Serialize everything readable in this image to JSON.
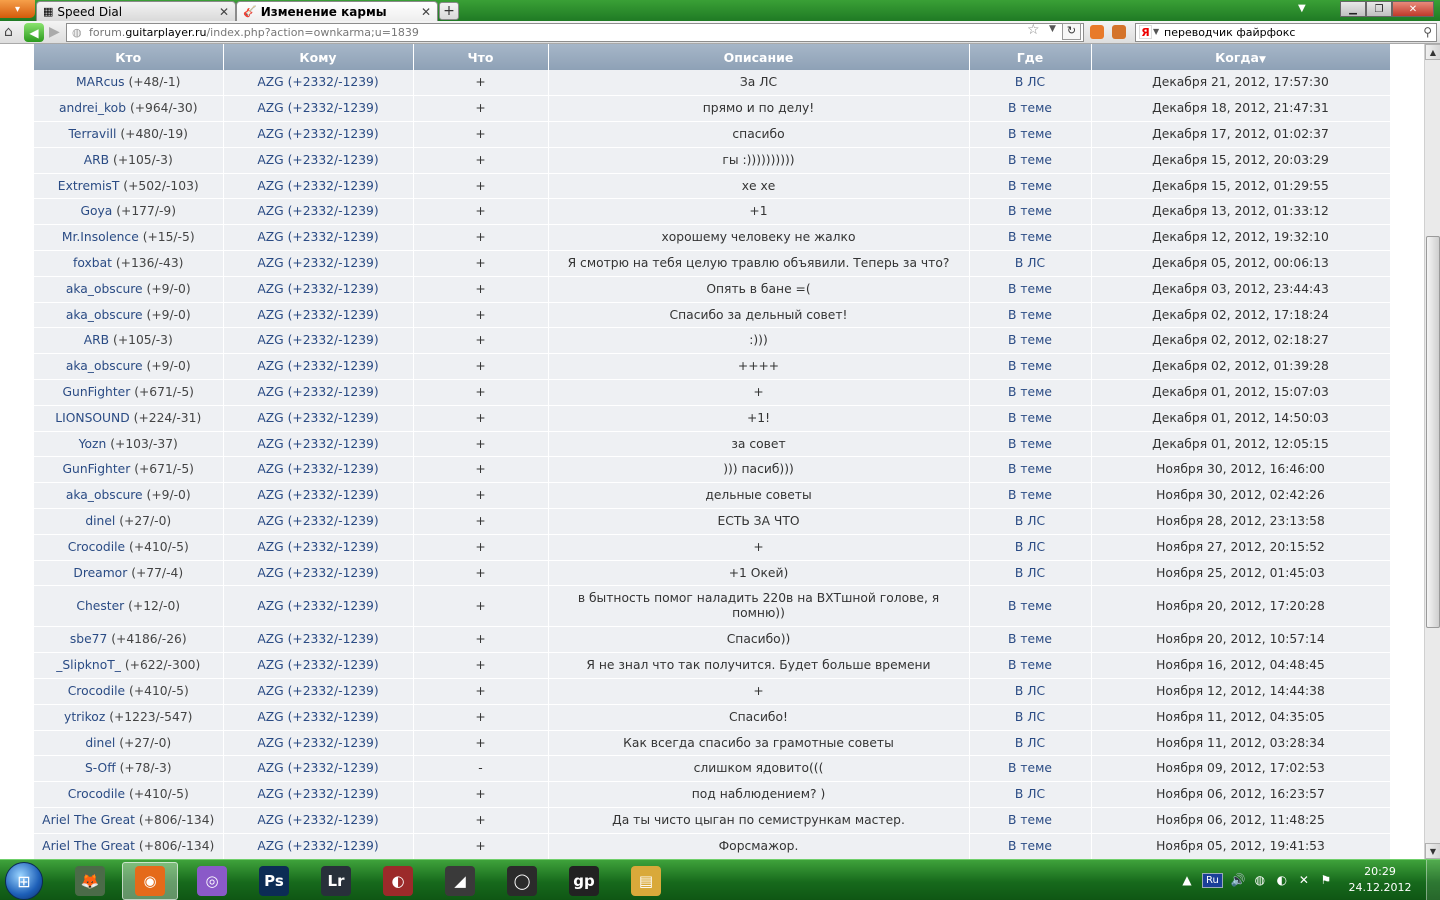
{
  "browser": {
    "firefox_button": "▾",
    "tabs": [
      {
        "title": "Speed Dial",
        "icon": "grid-icon",
        "active": false
      },
      {
        "title": "Изменение кармы",
        "icon": "guitar-icon",
        "active": true
      }
    ],
    "new_tab": "+",
    "url_prefix": "forum.",
    "url_domain": "guitarplayer.ru",
    "url_path": "/index.php?action=ownkarma;u=1839",
    "search_query": "переводчик файрфокс",
    "search_engine": "Я"
  },
  "table": {
    "headers": {
      "who": "Кто",
      "to": "Кому",
      "what": "Что",
      "desc": "Описание",
      "where": "Где",
      "when": "Когда"
    },
    "rows": [
      {
        "who": "MARcus",
        "score": "(+48/-1)",
        "to": "AZG (+2332/-1239)",
        "what": "+",
        "desc": "За ЛС",
        "where": "В ЛС",
        "when": "Декабря 21, 2012, 17:57:30"
      },
      {
        "who": "andrei_kob",
        "score": "(+964/-30)",
        "to": "AZG (+2332/-1239)",
        "what": "+",
        "desc": "прямо и по делу!",
        "where": "В теме",
        "when": "Декабря 18, 2012, 21:47:31"
      },
      {
        "who": "Terravill",
        "score": "(+480/-19)",
        "to": "AZG (+2332/-1239)",
        "what": "+",
        "desc": "спасибо",
        "where": "В теме",
        "when": "Декабря 17, 2012, 01:02:37"
      },
      {
        "who": "ARB",
        "score": "(+105/-3)",
        "to": "AZG (+2332/-1239)",
        "what": "+",
        "desc": "гы :))))))))))",
        "where": "В теме",
        "when": "Декабря 15, 2012, 20:03:29"
      },
      {
        "who": "ExtremisT",
        "score": "(+502/-103)",
        "to": "AZG (+2332/-1239)",
        "what": "+",
        "desc": "хе хе",
        "where": "В теме",
        "when": "Декабря 15, 2012, 01:29:55"
      },
      {
        "who": "Goya",
        "score": "(+177/-9)",
        "to": "AZG (+2332/-1239)",
        "what": "+",
        "desc": "+1",
        "where": "В теме",
        "when": "Декабря 13, 2012, 01:33:12"
      },
      {
        "who": "Mr.Insolence",
        "score": "(+15/-5)",
        "to": "AZG (+2332/-1239)",
        "what": "+",
        "desc": "хорошему человеку не жалко",
        "where": "В теме",
        "when": "Декабря 12, 2012, 19:32:10"
      },
      {
        "who": "foxbat",
        "score": "(+136/-43)",
        "to": "AZG (+2332/-1239)",
        "what": "+",
        "desc": "Я смотрю на тебя целую травлю объявили. Теперь за что?",
        "where": "В ЛС",
        "when": "Декабря 05, 2012, 00:06:13"
      },
      {
        "who": "aka_obscure",
        "score": "(+9/-0)",
        "to": "AZG (+2332/-1239)",
        "what": "+",
        "desc": "Опять в бане =(",
        "where": "В теме",
        "when": "Декабря 03, 2012, 23:44:43"
      },
      {
        "who": "aka_obscure",
        "score": "(+9/-0)",
        "to": "AZG (+2332/-1239)",
        "what": "+",
        "desc": "Спасибо за дельный совет!",
        "where": "В теме",
        "when": "Декабря 02, 2012, 17:18:24"
      },
      {
        "who": "ARB",
        "score": "(+105/-3)",
        "to": "AZG (+2332/-1239)",
        "what": "+",
        "desc": ":)))",
        "where": "В теме",
        "when": "Декабря 02, 2012, 02:18:27"
      },
      {
        "who": "aka_obscure",
        "score": "(+9/-0)",
        "to": "AZG (+2332/-1239)",
        "what": "+",
        "desc": "++++",
        "where": "В теме",
        "when": "Декабря 02, 2012, 01:39:28"
      },
      {
        "who": "GunFighter",
        "score": "(+671/-5)",
        "to": "AZG (+2332/-1239)",
        "what": "+",
        "desc": "+",
        "where": "В теме",
        "when": "Декабря 01, 2012, 15:07:03"
      },
      {
        "who": "LIONSOUND",
        "score": "(+224/-31)",
        "to": "AZG (+2332/-1239)",
        "what": "+",
        "desc": "+1!",
        "where": "В теме",
        "when": "Декабря 01, 2012, 14:50:03"
      },
      {
        "who": "Yozn",
        "score": "(+103/-37)",
        "to": "AZG (+2332/-1239)",
        "what": "+",
        "desc": "за совет",
        "where": "В теме",
        "when": "Декабря 01, 2012, 12:05:15"
      },
      {
        "who": "GunFighter",
        "score": "(+671/-5)",
        "to": "AZG (+2332/-1239)",
        "what": "+",
        "desc": "))) пасиб)))",
        "where": "В теме",
        "when": "Ноября 30, 2012, 16:46:00"
      },
      {
        "who": "aka_obscure",
        "score": "(+9/-0)",
        "to": "AZG (+2332/-1239)",
        "what": "+",
        "desc": "дельные советы",
        "where": "В теме",
        "when": "Ноября 30, 2012, 02:42:26"
      },
      {
        "who": "dinel",
        "score": "(+27/-0)",
        "to": "AZG (+2332/-1239)",
        "what": "+",
        "desc": "ЕСТЬ ЗА ЧТО",
        "where": "В ЛС",
        "when": "Ноября 28, 2012, 23:13:58"
      },
      {
        "who": "Crocodile",
        "score": "(+410/-5)",
        "to": "AZG (+2332/-1239)",
        "what": "+",
        "desc": "+",
        "where": "В ЛС",
        "when": "Ноября 27, 2012, 20:15:52"
      },
      {
        "who": "Dreamor",
        "score": "(+77/-4)",
        "to": "AZG (+2332/-1239)",
        "what": "+",
        "desc": "+1 Окей)",
        "where": "В ЛС",
        "when": "Ноября 25, 2012, 01:45:03"
      },
      {
        "who": "Chester",
        "score": "(+12/-0)",
        "to": "AZG (+2332/-1239)",
        "what": "+",
        "desc": "в бытность помог наладить 220в на ВХТшной голове, я помню))",
        "where": "В теме",
        "when": "Ноября 20, 2012, 17:20:28"
      },
      {
        "who": "sbe77",
        "score": "(+4186/-26)",
        "to": "AZG (+2332/-1239)",
        "what": "+",
        "desc": "Спасибо))",
        "where": "В теме",
        "when": "Ноября 20, 2012, 10:57:14"
      },
      {
        "who": "_SlipknoT_",
        "score": "(+622/-300)",
        "to": "AZG (+2332/-1239)",
        "what": "+",
        "desc": "Я не знал что так получится. Будет больше времени",
        "where": "В теме",
        "when": "Ноября 16, 2012, 04:48:45"
      },
      {
        "who": "Crocodile",
        "score": "(+410/-5)",
        "to": "AZG (+2332/-1239)",
        "what": "+",
        "desc": "+",
        "where": "В ЛС",
        "when": "Ноября 12, 2012, 14:44:38"
      },
      {
        "who": "ytrikoz",
        "score": "(+1223/-547)",
        "to": "AZG (+2332/-1239)",
        "what": "+",
        "desc": "Спасибо!",
        "where": "В ЛС",
        "when": "Ноября 11, 2012, 04:35:05"
      },
      {
        "who": "dinel",
        "score": "(+27/-0)",
        "to": "AZG (+2332/-1239)",
        "what": "+",
        "desc": "Как всегда спасибо за грамотные советы",
        "where": "В ЛС",
        "when": "Ноября 11, 2012, 03:28:34"
      },
      {
        "who": "S-Off",
        "score": "(+78/-3)",
        "to": "AZG (+2332/-1239)",
        "what": "-",
        "desc": "слишком ядовито(((",
        "where": "В теме",
        "when": "Ноября 09, 2012, 17:02:53"
      },
      {
        "who": "Crocodile",
        "score": "(+410/-5)",
        "to": "AZG (+2332/-1239)",
        "what": "+",
        "desc": "под наблюдением? )",
        "where": "В ЛС",
        "when": "Ноября 06, 2012, 16:23:57"
      },
      {
        "who": "Ariel The Great",
        "score": "(+806/-134)",
        "to": "AZG (+2332/-1239)",
        "what": "+",
        "desc": "Да ты чисто цыган по семистрункам мастер.",
        "where": "В теме",
        "when": "Ноября 06, 2012, 11:48:25"
      },
      {
        "who": "Ariel The Great",
        "score": "(+806/-134)",
        "to": "AZG (+2332/-1239)",
        "what": "+",
        "desc": "Форсмажор.",
        "where": "В теме",
        "when": "Ноября 05, 2012, 19:41:53"
      }
    ]
  },
  "taskbar": {
    "apps": [
      {
        "name": "taskbar-app-falcon",
        "glyph": "🦊",
        "color": "#4b6b48"
      },
      {
        "name": "taskbar-app-firefox",
        "glyph": "◉",
        "color": "#e56a1a"
      },
      {
        "name": "taskbar-app-disc",
        "glyph": "◎",
        "color": "#8a5ac8"
      },
      {
        "name": "taskbar-app-photoshop",
        "glyph": "Ps",
        "color": "#0c2c55"
      },
      {
        "name": "taskbar-app-lightroom",
        "glyph": "Lr",
        "color": "#28303a"
      },
      {
        "name": "taskbar-app-flstudio",
        "glyph": "◐",
        "color": "#9c2a2a"
      },
      {
        "name": "taskbar-app-steam",
        "glyph": "◢",
        "color": "#3a3a3a"
      },
      {
        "name": "taskbar-app-opera",
        "glyph": "◯",
        "color": "#2b2b2b"
      },
      {
        "name": "taskbar-app-guitarpro",
        "glyph": "gp",
        "color": "#222222"
      },
      {
        "name": "taskbar-app-explorer",
        "glyph": "▤",
        "color": "#d9a93a"
      }
    ],
    "lang": "Ru",
    "time": "20:29",
    "date": "24.12.2012"
  }
}
